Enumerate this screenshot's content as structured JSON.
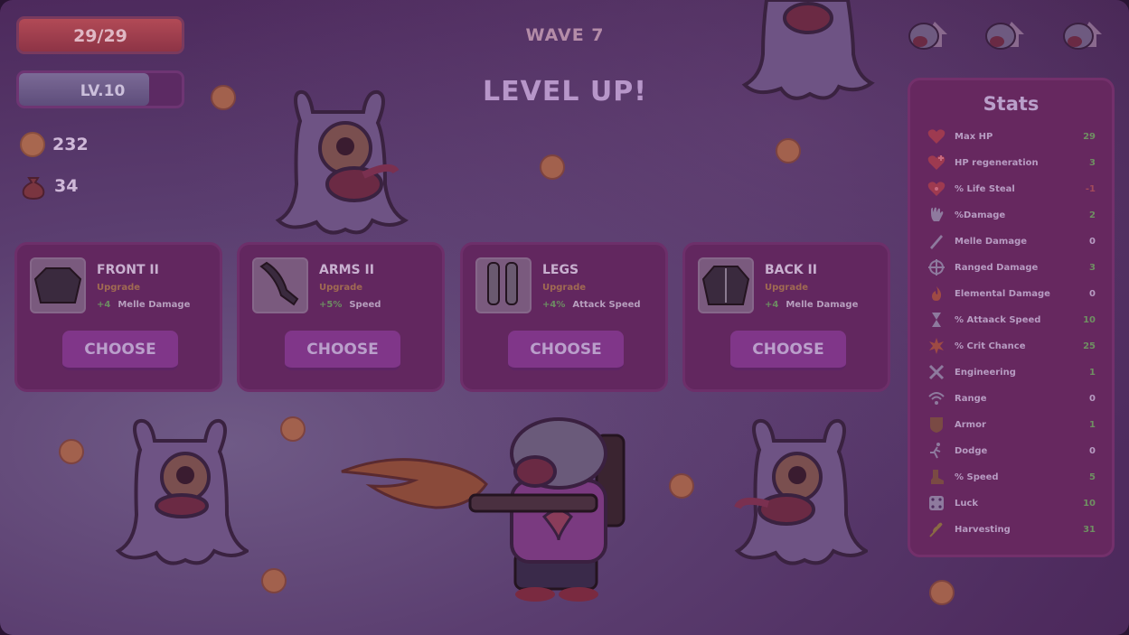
{
  "hud": {
    "hp_text": "29/29",
    "hp_fraction": 1.0,
    "level_text": "LV.10",
    "level_progress": 0.8,
    "coins": "232",
    "bags": "34",
    "wave": "WAVE 7",
    "banner": "LEVEL UP!"
  },
  "cards": [
    {
      "name": "FRONT II",
      "kind": "Upgrade",
      "bonus_value": "+4",
      "bonus_stat": "Melle Damage",
      "choose": "CHOOSE",
      "icon": "jacket-icon"
    },
    {
      "name": "ARMS II",
      "kind": "Upgrade",
      "bonus_value": "+5%",
      "bonus_stat": "Speed",
      "choose": "CHOOSE",
      "icon": "arm-icon"
    },
    {
      "name": "LEGS",
      "kind": "Upgrade",
      "bonus_value": "+4%",
      "bonus_stat": "Attack Speed",
      "choose": "CHOOSE",
      "icon": "legs-icon"
    },
    {
      "name": "BACK II",
      "kind": "Upgrade",
      "bonus_value": "+4",
      "bonus_stat": "Melle Damage",
      "choose": "CHOOSE",
      "icon": "vest-icon"
    }
  ],
  "stats": {
    "title": "Stats",
    "rows": [
      {
        "label": "Max HP",
        "value": "29",
        "value_color": "#6f8f62",
        "icon": "heart-icon"
      },
      {
        "label": "HP regeneration",
        "value": "3",
        "value_color": "#6f8f62",
        "icon": "heart-plus-icon"
      },
      {
        "label": "% Life Steal",
        "value": "-1",
        "value_color": "#a24a5a",
        "icon": "heart-drop-icon"
      },
      {
        "label": "%Damage",
        "value": "2",
        "value_color": "#6f8f62",
        "icon": "fist-icon"
      },
      {
        "label": "Melle Damage",
        "value": "0",
        "value_color": "#b79cc2",
        "icon": "sword-icon"
      },
      {
        "label": "Ranged Damage",
        "value": "3",
        "value_color": "#6f8f62",
        "icon": "crosshair-icon"
      },
      {
        "label": "Elemental Damage",
        "value": "0",
        "value_color": "#b79cc2",
        "icon": "flame-icon"
      },
      {
        "label": "% Attaack Speed",
        "value": "10",
        "value_color": "#6f8f62",
        "icon": "hourglass-icon"
      },
      {
        "label": "% Crit Chance",
        "value": "25",
        "value_color": "#6f8f62",
        "icon": "burst-icon"
      },
      {
        "label": "Engineering",
        "value": "1",
        "value_color": "#6f8f62",
        "icon": "wrench-icon"
      },
      {
        "label": "Range",
        "value": "0",
        "value_color": "#b79cc2",
        "icon": "signal-icon"
      },
      {
        "label": "Armor",
        "value": "1",
        "value_color": "#6f8f62",
        "icon": "shield-icon"
      },
      {
        "label": "Dodge",
        "value": "0",
        "value_color": "#b79cc2",
        "icon": "runner-icon"
      },
      {
        "label": "% Speed",
        "value": "5",
        "value_color": "#6f8f62",
        "icon": "boot-icon"
      },
      {
        "label": "Luck",
        "value": "10",
        "value_color": "#6f8f62",
        "icon": "dice-icon"
      },
      {
        "label": "Harvesting",
        "value": "31",
        "value_color": "#6f8f62",
        "icon": "wheat-icon"
      }
    ]
  }
}
